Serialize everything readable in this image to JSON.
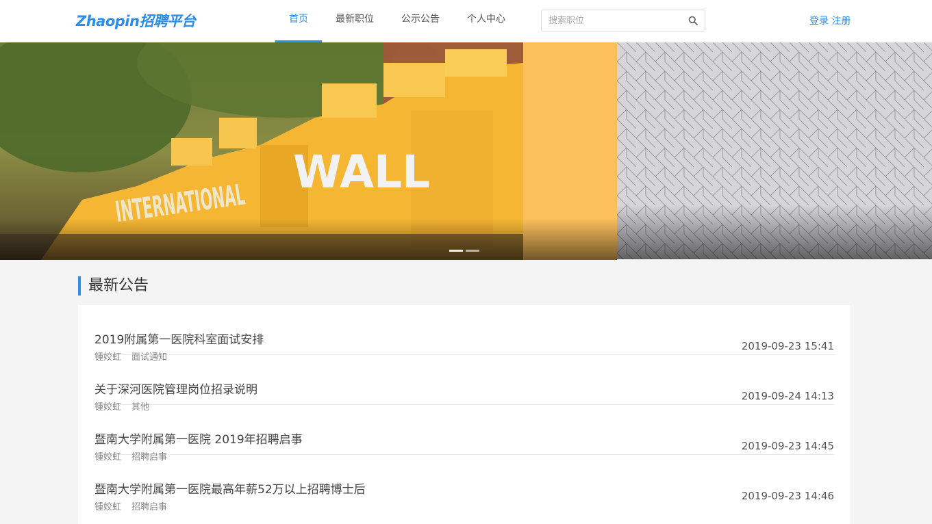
{
  "header": {
    "logo": "Zhaopin招聘平台",
    "nav": [
      "首页",
      "最新职位",
      "公示公告",
      "个人中心"
    ],
    "search_placeholder": "搜索职位",
    "login": "登录",
    "register": "注册"
  },
  "banner": {
    "slides_count": 2,
    "active_slide": 1,
    "photo_caption": "INTERNATIONAL WALL"
  },
  "section": {
    "title": "最新公告"
  },
  "announcements": [
    {
      "title": "2019附属第一医院科室面试安排",
      "author": "锺姣虹",
      "category": "面试通知",
      "date": "2019-09-23 15:41"
    },
    {
      "title": "关于深河医院管理岗位招录说明",
      "author": "锺姣虹",
      "category": "其他",
      "date": "2019-09-24 14:13"
    },
    {
      "title": "暨南大学附属第一医院 2019年招聘启事",
      "author": "锺姣虹",
      "category": "招聘启事",
      "date": "2019-09-23 14:45"
    },
    {
      "title": "暨南大学附属第一医院最高年薪52万以上招聘博士后",
      "author": "锺姣虹",
      "category": "招聘启事",
      "date": "2019-09-23 14:46"
    }
  ],
  "colors": {
    "accent": "#2b8ee8",
    "banner_yellow": "#fbbf5c",
    "background": "#f4f4f4"
  }
}
